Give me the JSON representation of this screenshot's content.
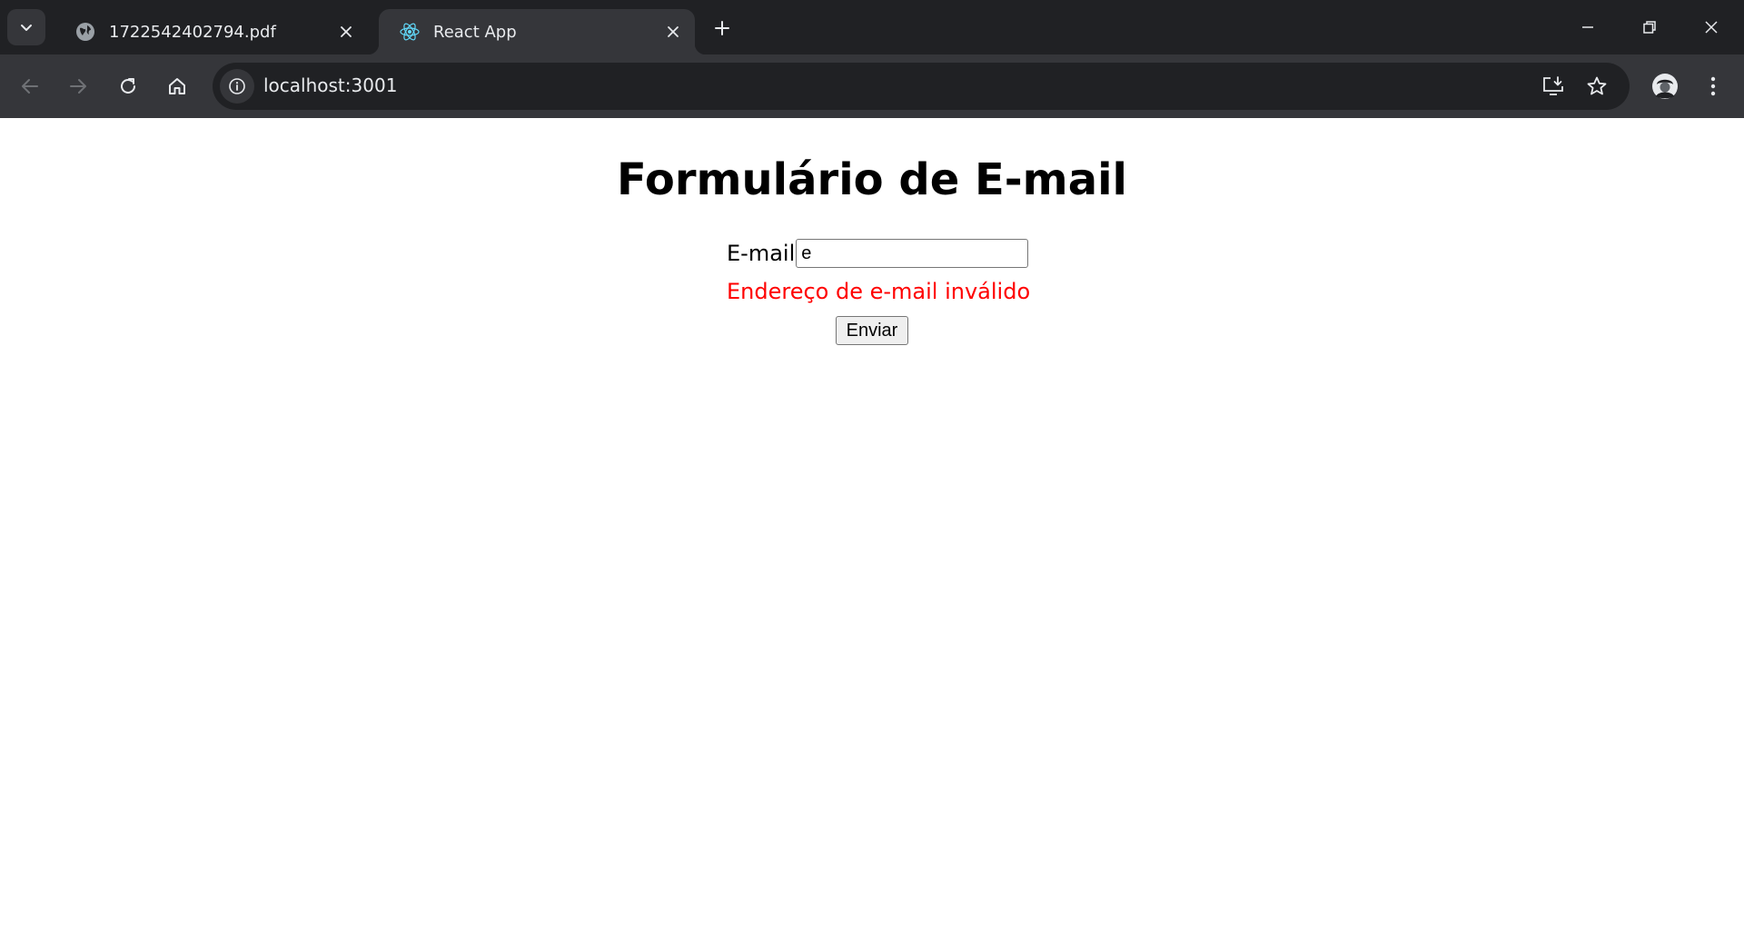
{
  "browser": {
    "tabs": [
      {
        "title": "1722542402794.pdf",
        "icon": "globe-icon",
        "active": false
      },
      {
        "title": "React App",
        "icon": "react-logo-icon",
        "active": true
      }
    ],
    "address_bar": {
      "url": "localhost:3001"
    }
  },
  "page": {
    "title": "Formulário de E-mail",
    "form": {
      "email_label": "E-mail",
      "email_value": "e",
      "error_message": "Endereço de e-mail inválido",
      "submit_label": "Enviar"
    }
  },
  "colors": {
    "error": "#ff0000",
    "chrome_dark": "#202124",
    "chrome_toolbar": "#35363a"
  }
}
